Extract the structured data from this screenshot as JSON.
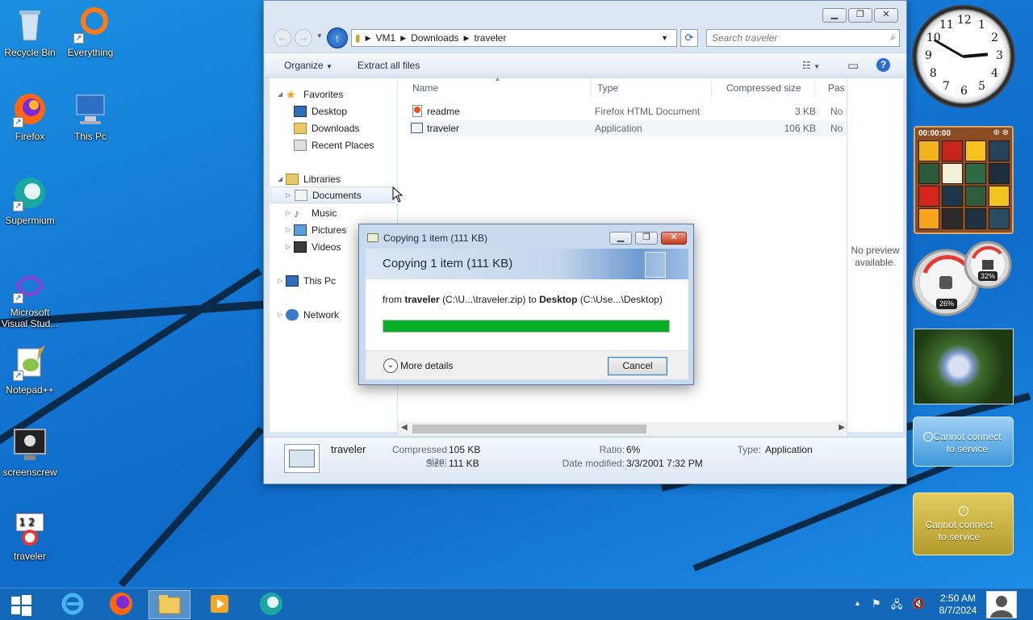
{
  "desktop_icons": [
    {
      "label": "Recycle Bin"
    },
    {
      "label": "Everything"
    },
    {
      "label": "Firefox"
    },
    {
      "label": "This Pc"
    },
    {
      "label": "Supermium"
    },
    {
      "label": "Microsoft Visual Stud..."
    },
    {
      "label": "Notepad++"
    },
    {
      "label": "screenscrew"
    },
    {
      "label": "traveler"
    }
  ],
  "explorer": {
    "address": [
      "VM1",
      "Downloads",
      "traveler"
    ],
    "search_placeholder": "Search traveler",
    "toolbar": {
      "organize": "Organize",
      "extract_all": "Extract all files"
    },
    "nav": {
      "favorites": "Favorites",
      "desktop": "Desktop",
      "downloads": "Downloads",
      "recent_places": "Recent Places",
      "libraries": "Libraries",
      "documents": "Documents",
      "music": "Music",
      "pictures": "Pictures",
      "videos": "Videos",
      "this_pc": "This Pc",
      "network": "Network"
    },
    "columns": {
      "name": "Name",
      "type": "Type",
      "compressed_size": "Compressed size",
      "password": "Pas"
    },
    "files": [
      {
        "name": "readme",
        "type": "Firefox HTML Document",
        "size": "3 KB",
        "password": "No"
      },
      {
        "name": "traveler",
        "type": "Application",
        "size": "106 KB",
        "password": "No"
      }
    ],
    "preview_text": "No preview available.",
    "details": {
      "name": "traveler",
      "compressed_size_label": "Compressed size:",
      "compressed_size": "105 KB",
      "size_label": "Size:",
      "size": "111 KB",
      "ratio_label": "Ratio:",
      "ratio": "6%",
      "date_label": "Date modified:",
      "date": "3/3/2001 7:32 PM",
      "type_label": "Type:",
      "type": "Application"
    }
  },
  "copy_dialog": {
    "title": "Copying 1 item (111 KB)",
    "heading": "Copying 1 item (111 KB)",
    "from_word": "from",
    "source_name": "traveler",
    "source_path": "(C:\\U...\\traveler.zip)",
    "to_word": "to",
    "dest_name": "Desktop",
    "dest_path": "(C:\\Use...\\Desktop)",
    "progress": 1.0,
    "more_details": "More details",
    "cancel": "Cancel"
  },
  "gadgets": {
    "clock_numbers": [
      "12",
      "1",
      "2",
      "3",
      "4",
      "5",
      "6",
      "7",
      "8",
      "9",
      "10",
      "11"
    ],
    "puzzle_timer": "00:00:00",
    "cpu_percent": "26%",
    "mem_percent": "32%",
    "weather1": "Cannot connect to service",
    "weather2": "Cannot connect to service"
  },
  "taskbar": {
    "time": "2:50 AM",
    "date": "8/7/2024"
  }
}
